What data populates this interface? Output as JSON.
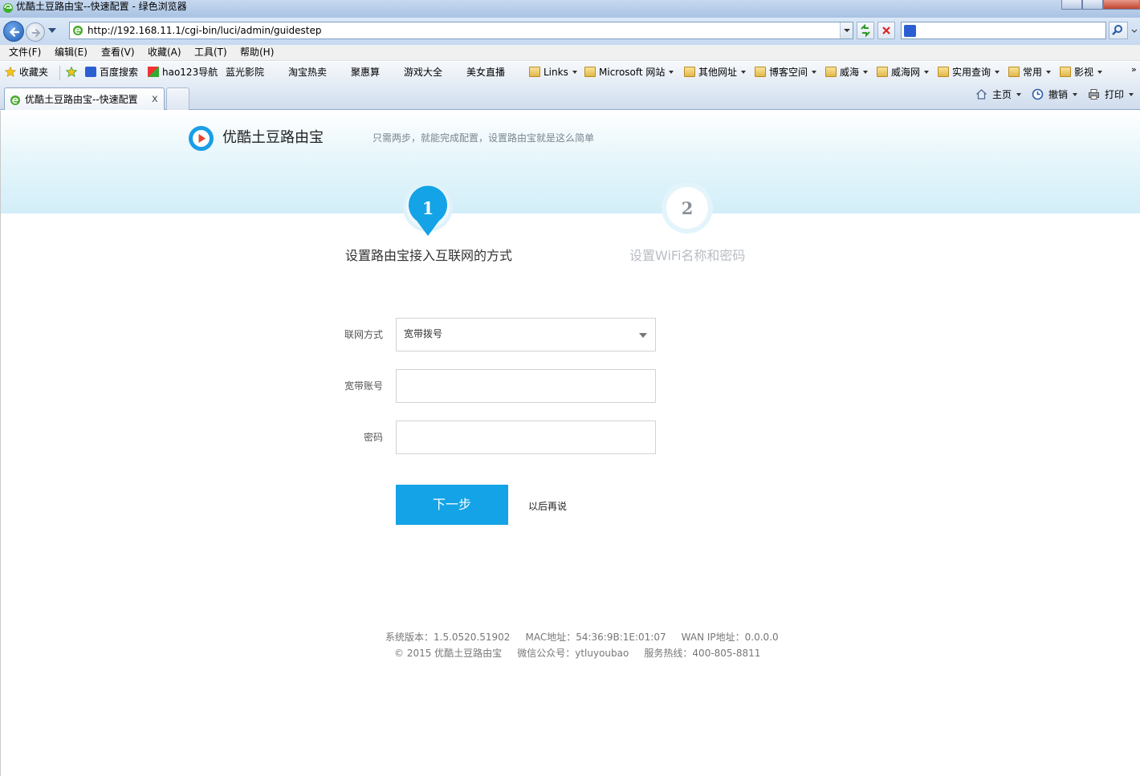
{
  "window": {
    "title": "优酷土豆路由宝--快速配置 - 绿色浏览器"
  },
  "address_bar": {
    "url": "http://192.168.11.1/cgi-bin/luci/admin/guidestep",
    "search_placeholder": ""
  },
  "menu": {
    "items": [
      "文件(F)",
      "编辑(E)",
      "查看(V)",
      "收藏(A)",
      "工具(T)",
      "帮助(H)"
    ]
  },
  "favorites": {
    "label": "收藏夹",
    "items": [
      {
        "label": "百度搜索",
        "icon": "baidu-icon"
      },
      {
        "label": "hao123导航",
        "icon": "hao123-icon"
      },
      {
        "label": "蓝光影院",
        "icon": "page-icon"
      },
      {
        "label": "淘宝热卖",
        "icon": "page-icon"
      },
      {
        "label": "聚惠算",
        "icon": "page-icon"
      },
      {
        "label": "游戏大全",
        "icon": "page-icon"
      },
      {
        "label": "美女直播",
        "icon": "page-icon"
      },
      {
        "label": "Links",
        "icon": "folder-icon"
      },
      {
        "label": "Microsoft 网站",
        "icon": "folder-icon"
      },
      {
        "label": "其他网址",
        "icon": "folder-icon"
      },
      {
        "label": "博客空间",
        "icon": "folder-icon"
      },
      {
        "label": "威海",
        "icon": "folder-icon"
      },
      {
        "label": "威海网",
        "icon": "folder-icon"
      },
      {
        "label": "实用查询",
        "icon": "folder-icon"
      },
      {
        "label": "常用",
        "icon": "folder-icon"
      },
      {
        "label": "影视",
        "icon": "folder-icon"
      }
    ]
  },
  "tabs": {
    "active_label": "优酷土豆路由宝--快速配置",
    "close_glyph": "x"
  },
  "commands": {
    "home": "主页",
    "undo": "撤销",
    "print": "打印"
  },
  "page": {
    "brand": {
      "name": "优酷土豆路由宝",
      "slogan": "只需两步，就能完成配置，设置路由宝就是这么简单"
    },
    "steps": [
      {
        "number": "1",
        "label": "设置路由宝接入互联网的方式",
        "active": true
      },
      {
        "number": "2",
        "label": "设置WiFi名称和密码",
        "active": false
      }
    ],
    "form": {
      "connection_type_label": "联网方式",
      "connection_type_value": "宽带拨号",
      "account_label": "宽带账号",
      "account_value": "",
      "password_label": "密码",
      "password_value": ""
    },
    "actions": {
      "next_label": "下一步",
      "later_label": "以后再说"
    },
    "footer": {
      "line1": "系统版本：1.5.0520.51902     MAC地址：54:36:9B:1E:01:07     WAN IP地址：0.0.0.0",
      "line2": "© 2015 优酷土豆路由宝     微信公众号：ytluyoubao     服务热线：400-805-8811"
    },
    "colors": {
      "accent": "#13a3e6",
      "step_inactive": "#b9bec4"
    }
  }
}
